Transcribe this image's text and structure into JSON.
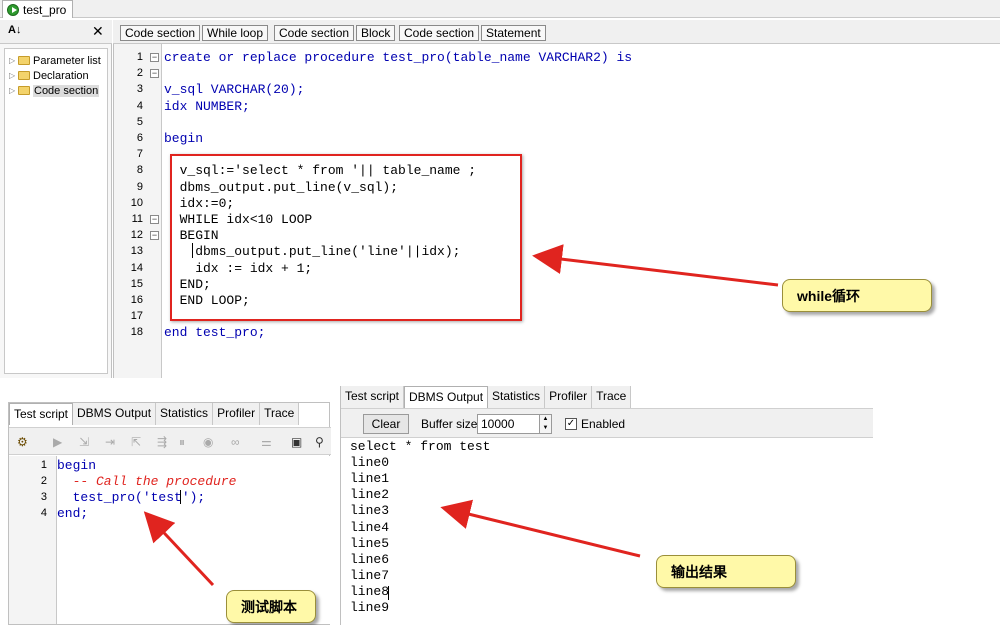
{
  "title_tab": "test_pro",
  "tree": {
    "items": [
      {
        "label": "Parameter list"
      },
      {
        "label": "Declaration"
      },
      {
        "label": "Code section"
      }
    ]
  },
  "left_toolbar": {
    "sort": "A↓",
    "close": "✕"
  },
  "toolbar": {
    "buttons": [
      "Code section",
      "While loop",
      "Code section",
      "Block",
      "Code section",
      "Statement"
    ]
  },
  "editor": {
    "lines": [
      "create or replace procedure test_pro(table_name VARCHAR2) is",
      "",
      "v_sql VARCHAR(20);",
      "idx NUMBER;",
      "",
      "begin",
      "",
      "  v_sql:='select * from '|| table_name ;",
      "  dbms_output.put_line(v_sql);",
      "  idx:=0;",
      "  WHILE idx<10 LOOP",
      "  BEGIN",
      "    dbms_output.put_line('line'||idx);",
      "    idx := idx + 1;",
      "  END;",
      "  END LOOP;",
      "",
      "end test_pro;"
    ]
  },
  "callout_while": "while循环",
  "callout_script": "测试脚本",
  "callout_output": "输出结果",
  "test_panel": {
    "tabs": [
      "Test script",
      "DBMS Output",
      "Statistics",
      "Profiler",
      "Trace"
    ],
    "lines": [
      "begin",
      "  -- Call the procedure",
      "  test_pro('test');",
      "end;"
    ]
  },
  "output_panel": {
    "tabs": [
      "Test script",
      "DBMS Output",
      "Statistics",
      "Profiler",
      "Trace"
    ],
    "clear_label": "Clear",
    "buffer_label": "Buffer size",
    "buffer_value": "10000",
    "enabled_label": "Enabled",
    "lines": [
      "select * from test",
      "line0",
      "line1",
      "line2",
      "line3",
      "line4",
      "line5",
      "line6",
      "line7",
      "line8",
      "line9"
    ]
  },
  "colors": {
    "keyword": "#0000b0",
    "comment": "#e0241f",
    "annotation": "#e0241f",
    "callout_bg": "#fff9a8"
  }
}
